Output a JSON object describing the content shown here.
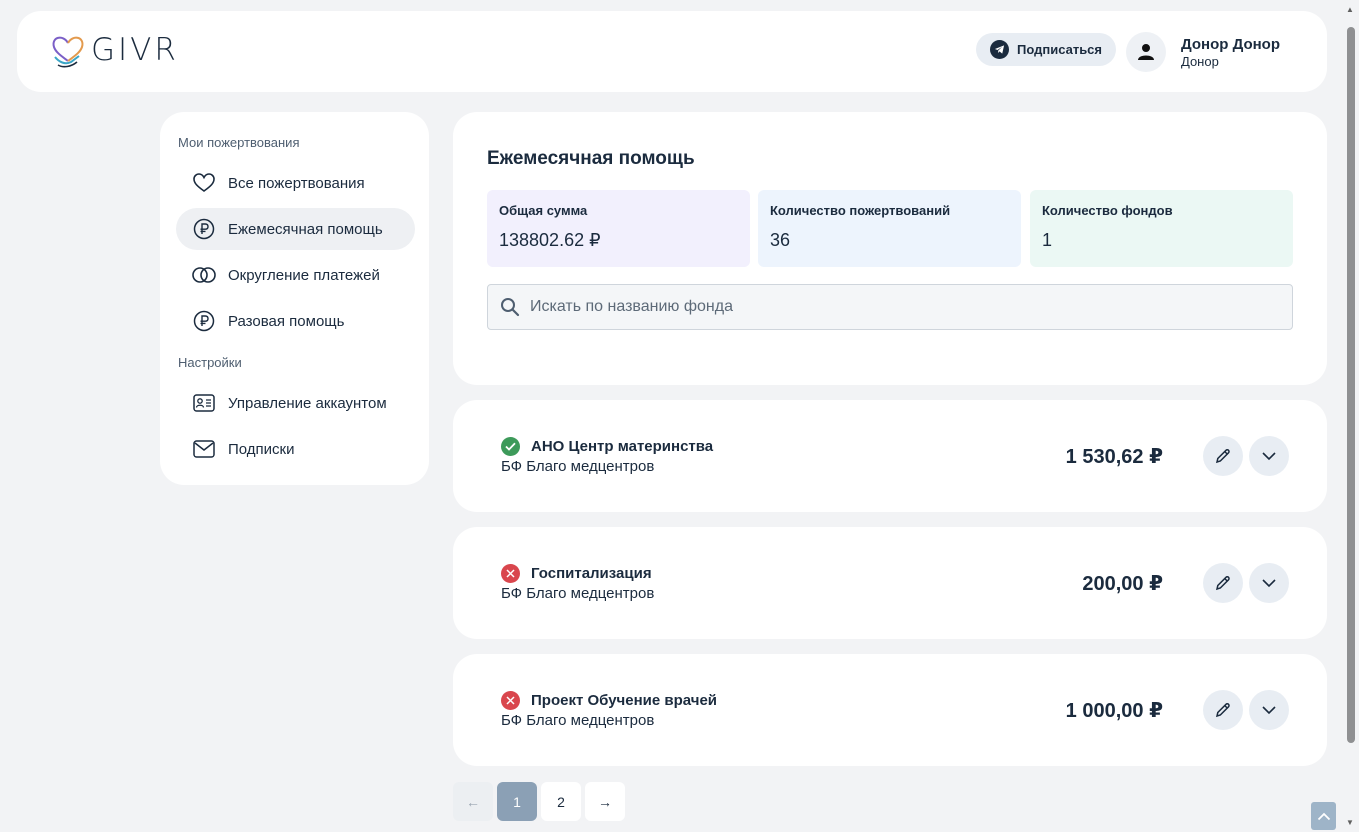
{
  "header": {
    "logo_text": "GIVR",
    "subscribe_label": "Подписаться",
    "user_name": "Донор Донор",
    "user_role": "Донор"
  },
  "sidebar": {
    "section_donations": "Мои пожертвования",
    "section_settings": "Настройки",
    "items": [
      {
        "label": "Все пожертвования",
        "icon": "heart-icon"
      },
      {
        "label": "Ежемесячная помощь",
        "icon": "ruble-coin-icon",
        "active": true
      },
      {
        "label": "Округление платежей",
        "icon": "rings-icon"
      },
      {
        "label": "Разовая помощь",
        "icon": "ruble-coin-icon"
      },
      {
        "label": "Управление аккаунтом",
        "icon": "id-card-icon"
      },
      {
        "label": "Подписки",
        "icon": "mail-icon"
      }
    ]
  },
  "summary": {
    "title": "Ежемесячная помощь",
    "stats": [
      {
        "label": "Общая сумма",
        "value": "138802.62 ₽",
        "color": "#f2f0fd"
      },
      {
        "label": "Количество пожертвований",
        "value": "36",
        "color": "#edf4fd"
      },
      {
        "label": "Количество фондов",
        "value": "1",
        "color": "#ebf8f4"
      }
    ],
    "search_placeholder": "Искать по названию фонда"
  },
  "donations": [
    {
      "title": "АНО Центр материнства",
      "fund": "БФ Благо медцентров",
      "amount": "1 530,62 ₽",
      "status": "active"
    },
    {
      "title": "Госпитализация",
      "fund": "БФ Благо медцентров",
      "amount": "200,00 ₽",
      "status": "cancelled"
    },
    {
      "title": "Проект Обучение врачей",
      "fund": "БФ Благо медцентров",
      "amount": "1 000,00 ₽",
      "status": "cancelled"
    }
  ],
  "pagination": {
    "prev": "←",
    "pages": [
      "1",
      "2"
    ],
    "current": "1",
    "next": "→"
  },
  "colors": {
    "accent": "#1b2b3e",
    "status_active": "#3d9a5a",
    "status_cancelled": "#d9464d",
    "page_active": "#8ba0b5"
  }
}
